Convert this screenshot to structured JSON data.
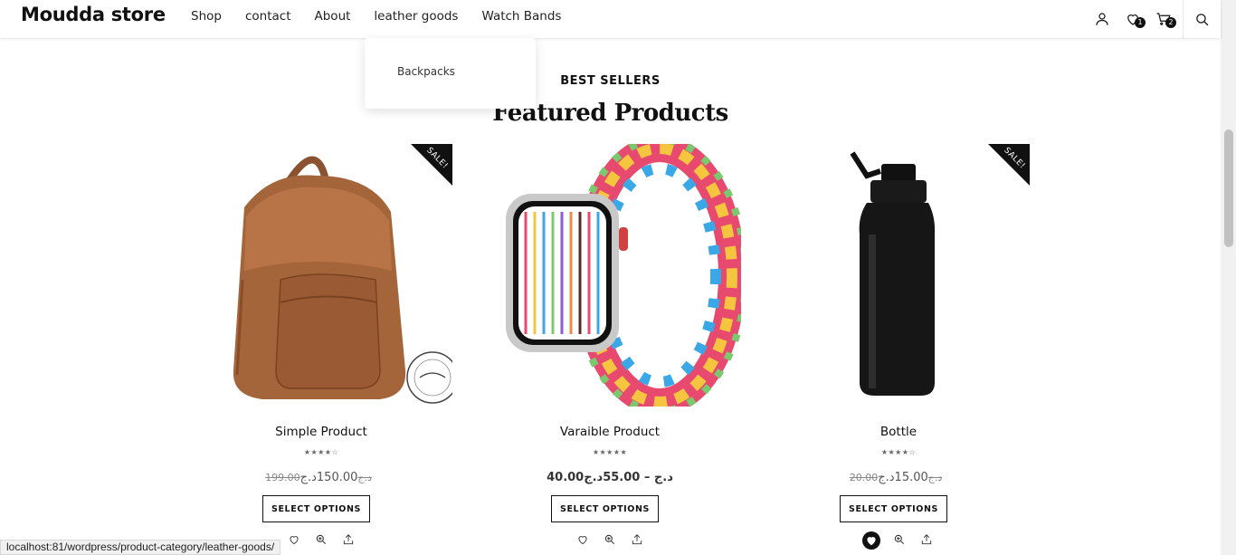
{
  "header": {
    "logo": "Moudda store",
    "nav": [
      "Shop",
      "contact",
      "About",
      "leather goods",
      "Watch Bands"
    ],
    "wishlist_count": "1",
    "cart_count": "2"
  },
  "dropdown": {
    "items": [
      "Backpacks"
    ]
  },
  "section": {
    "eyebrow": "BEST SELLERS",
    "title": "Featured Products"
  },
  "products": [
    {
      "name": "Simple Product",
      "old_price": "199.00د.ج",
      "price": "150.00د.ج",
      "button": "SELECT OPTIONS",
      "sale": "SALE!",
      "stars": "★★★★☆"
    },
    {
      "name": "Varaible Product",
      "price_range": "40.00د.ج – 55.00د.ج",
      "button": "SELECT OPTIONS",
      "stars": "★★★★★"
    },
    {
      "name": "Bottle",
      "old_price": "20.00د.ج",
      "price": "15.00د.ج",
      "button": "SELECT OPTIONS",
      "sale": "SALE!",
      "stars": "★★★★☆"
    }
  ],
  "status_bar": "localhost:81/wordpress/product-category/leather-goods/",
  "colors": {
    "accent": "#111111",
    "leather": "#a5653a"
  }
}
